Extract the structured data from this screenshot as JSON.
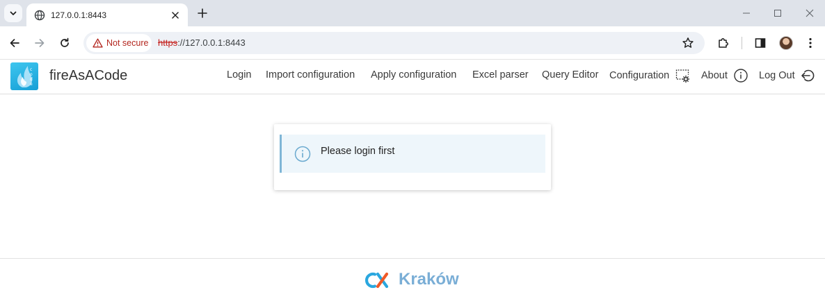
{
  "browser": {
    "tab_title": "127.0.0.1:8443",
    "security_chip": "Not secure",
    "url_scheme": "https",
    "url_rest": "://127.0.0.1:8443"
  },
  "app": {
    "brand": "fireAsACode",
    "nav": {
      "login": "Login",
      "import_configuration": "Import configuration",
      "apply_configuration": "Apply configuration",
      "excel_parser": "Excel parser",
      "query_editor": "Query Editor",
      "configuration": "Configuration",
      "about": "About",
      "log_out": "Log Out"
    }
  },
  "main": {
    "alert_text": "Please login first"
  },
  "footer": {
    "logo_letters": "CX",
    "city": "Kraków"
  },
  "colors": {
    "accent_blue": "#169fd6",
    "alert_bg": "#eef6fb",
    "alert_border": "#7fb6d6",
    "footer_text": "#7aaed6",
    "not_secure_red": "#b3261e"
  }
}
